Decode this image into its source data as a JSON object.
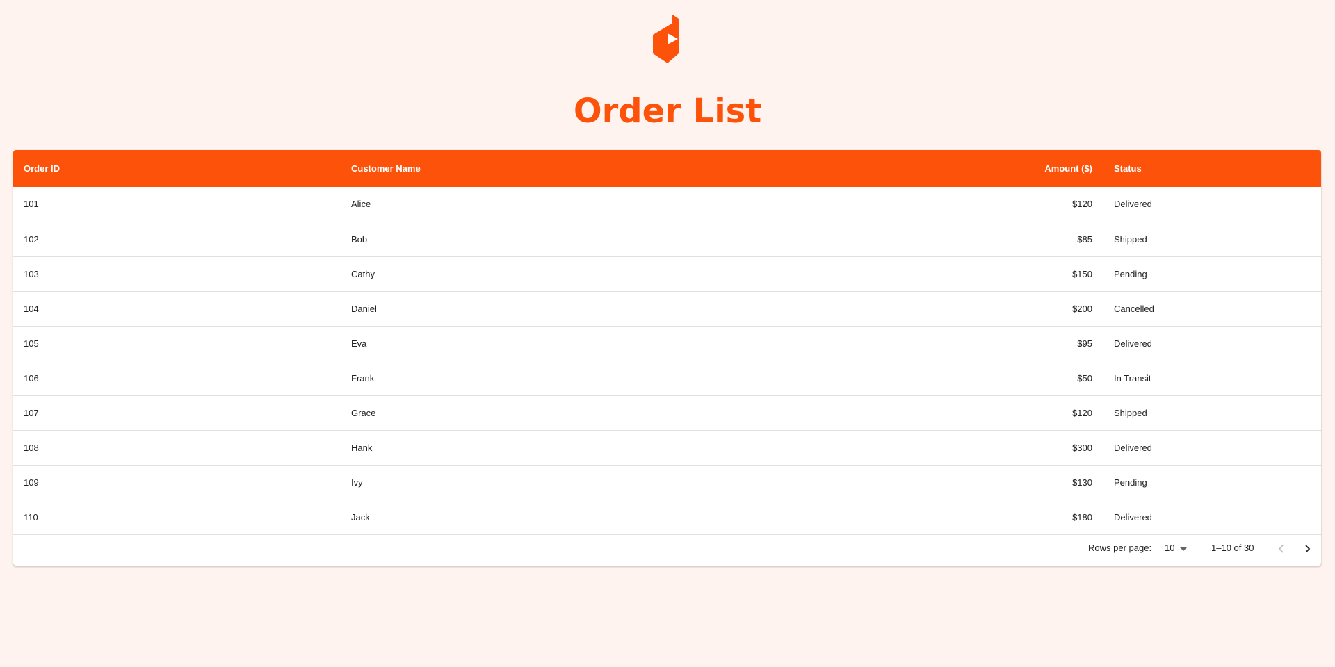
{
  "colors": {
    "accent": "#fc520a",
    "background": "#fff3ef",
    "header_text": "#ffffff"
  },
  "logo": {
    "icon": "play-hexagon-logo-icon"
  },
  "page_title": "Order List",
  "table": {
    "columns": {
      "order_id": "Order ID",
      "customer_name": "Customer Name",
      "amount": "Amount ($)",
      "status": "Status"
    },
    "rows": [
      {
        "order_id": "101",
        "customer_name": "Alice",
        "amount": "$120",
        "status": "Delivered"
      },
      {
        "order_id": "102",
        "customer_name": "Bob",
        "amount": "$85",
        "status": "Shipped"
      },
      {
        "order_id": "103",
        "customer_name": "Cathy",
        "amount": "$150",
        "status": "Pending"
      },
      {
        "order_id": "104",
        "customer_name": "Daniel",
        "amount": "$200",
        "status": "Cancelled"
      },
      {
        "order_id": "105",
        "customer_name": "Eva",
        "amount": "$95",
        "status": "Delivered"
      },
      {
        "order_id": "106",
        "customer_name": "Frank",
        "amount": "$50",
        "status": "In Transit"
      },
      {
        "order_id": "107",
        "customer_name": "Grace",
        "amount": "$120",
        "status": "Shipped"
      },
      {
        "order_id": "108",
        "customer_name": "Hank",
        "amount": "$300",
        "status": "Delivered"
      },
      {
        "order_id": "109",
        "customer_name": "Ivy",
        "amount": "$130",
        "status": "Pending"
      },
      {
        "order_id": "110",
        "customer_name": "Jack",
        "amount": "$180",
        "status": "Delivered"
      }
    ]
  },
  "pagination": {
    "rows_per_page_label": "Rows per page:",
    "rows_per_page_value": "10",
    "range_text": "1–10 of 30",
    "prev_icon": "chevron-left-icon",
    "next_icon": "chevron-right-icon",
    "prev_disabled": true
  }
}
